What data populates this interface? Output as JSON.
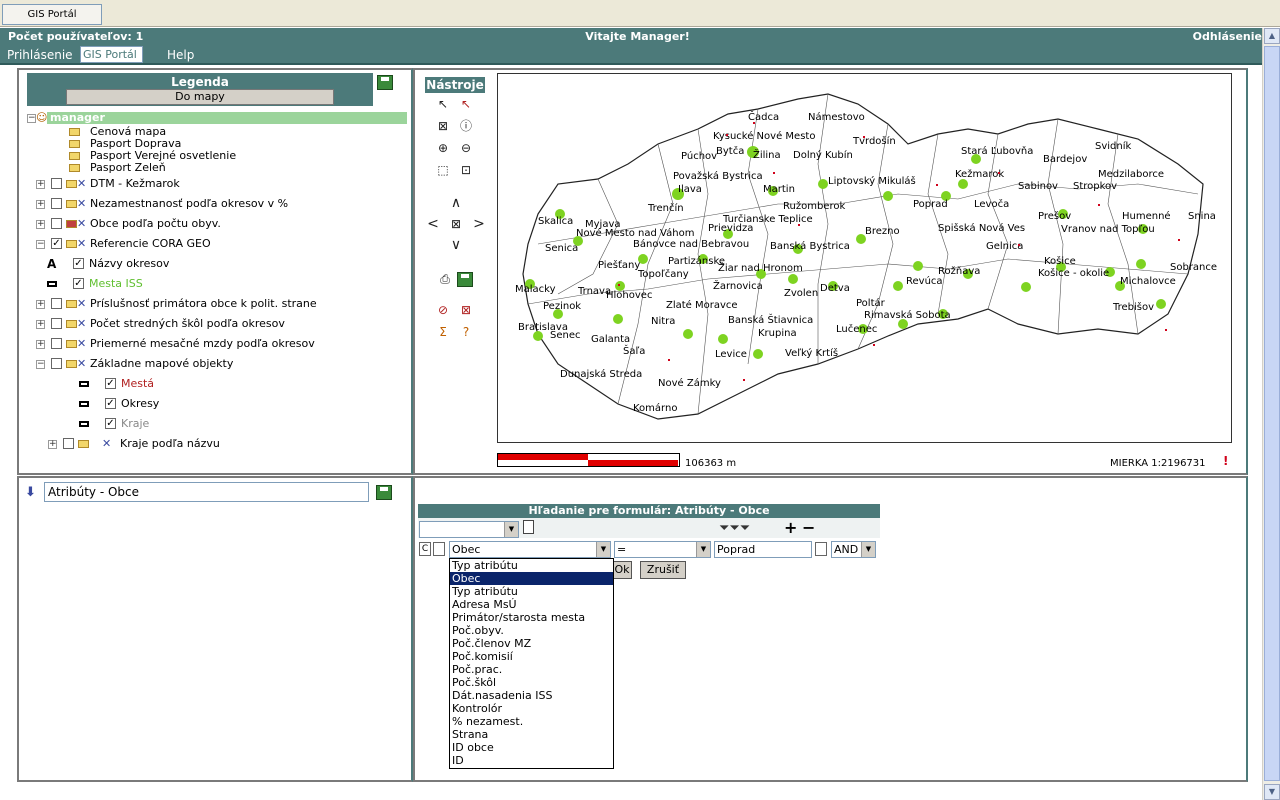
{
  "taskbar": {
    "button_label": "GIS Portál"
  },
  "header": {
    "user_count": "Počet používateľov: 1",
    "welcome": "Vitajte Manager!",
    "logout": "Odhlásenie"
  },
  "menu": {
    "tabs": [
      {
        "label": "Prihlásenie"
      },
      {
        "label": "GIS Portál"
      },
      {
        "label": "Help"
      }
    ]
  },
  "legend": {
    "title": "Legenda",
    "to_map_button": "Do mapy",
    "user": "manager",
    "items": [
      {
        "label": "Cenová mapa"
      },
      {
        "label": "Pasport Doprava"
      },
      {
        "label": "Pasport Verejné osvetlenie"
      },
      {
        "label": "Pasport Zeleň"
      },
      {
        "label": "DTM - Kežmarok"
      },
      {
        "label": "Nezamestnanosť podľa okresov v %"
      },
      {
        "label": "Obce podľa počtu obyv."
      },
      {
        "label": "Referencie CORA GEO"
      },
      {
        "label": "Názvy okresov"
      },
      {
        "label": "Mesta ISS"
      },
      {
        "label": "Príslušnosť primátora obce k polit. strane"
      },
      {
        "label": "Počet stredných škôl podľa okresov"
      },
      {
        "label": "Priemerné mesačné mzdy podľa okresov"
      },
      {
        "label": "Základne mapové objekty"
      },
      {
        "label": "Mestá"
      },
      {
        "label": "Okresy"
      },
      {
        "label": "Kraje"
      },
      {
        "label": "Kraje podľa názvu"
      }
    ]
  },
  "tools": {
    "title": "Nástroje"
  },
  "map": {
    "scale_distance": "106363 m",
    "scale_ratio": "MIERKA 1:2196731",
    "places": [
      {
        "name": "Čadca"
      },
      {
        "name": "Námestovo"
      },
      {
        "name": "Kysucké Nové Mesto"
      },
      {
        "name": "Tvrdošín"
      },
      {
        "name": "Bytča"
      },
      {
        "name": "Púchov"
      },
      {
        "name": "Žilina"
      },
      {
        "name": "Dolný Kubín"
      },
      {
        "name": "Stará Ľubovňa"
      },
      {
        "name": "Svidník"
      },
      {
        "name": "Bardejov"
      },
      {
        "name": "Kežmarok"
      },
      {
        "name": "Medzilaborce"
      },
      {
        "name": "Považská Bystrica"
      },
      {
        "name": "Liptovský Mikuláš"
      },
      {
        "name": "Sabinov"
      },
      {
        "name": "Stropkov"
      },
      {
        "name": "Ilava"
      },
      {
        "name": "Martin"
      },
      {
        "name": "Ružomberok"
      },
      {
        "name": "Poprad"
      },
      {
        "name": "Levoča"
      },
      {
        "name": "Trenčín"
      },
      {
        "name": "Prešov"
      },
      {
        "name": "Humenné"
      },
      {
        "name": "Snina"
      },
      {
        "name": "Skalica"
      },
      {
        "name": "Turčianske Teplice"
      },
      {
        "name": "Vranov nad Topľou"
      },
      {
        "name": "Myjava"
      },
      {
        "name": "Prievidza"
      },
      {
        "name": "Spišská Nová Ves"
      },
      {
        "name": "Nové Mesto nad Váhom"
      },
      {
        "name": "Brezno"
      },
      {
        "name": "Bánovce nad Bebravou"
      },
      {
        "name": "Banská Bystrica"
      },
      {
        "name": "Senica"
      },
      {
        "name": "Gelnica"
      },
      {
        "name": "Partizánske"
      },
      {
        "name": "Piešťany"
      },
      {
        "name": "Žiar nad Hronom"
      },
      {
        "name": "Rožňava"
      },
      {
        "name": "Topoľčany"
      },
      {
        "name": "Košice - okolie"
      },
      {
        "name": "Košice"
      },
      {
        "name": "Sobrance"
      },
      {
        "name": "Revúca"
      },
      {
        "name": "Michalovce"
      },
      {
        "name": "Malacky"
      },
      {
        "name": "Trnava"
      },
      {
        "name": "Žarnovica"
      },
      {
        "name": "Zvolen"
      },
      {
        "name": "Detva"
      },
      {
        "name": "Hlohovec"
      },
      {
        "name": "Zlaté Moravce"
      },
      {
        "name": "Poltár"
      },
      {
        "name": "Pezinok"
      },
      {
        "name": "Trebišov"
      },
      {
        "name": "Rimavská Sobota"
      },
      {
        "name": "Banská Štiavnica"
      },
      {
        "name": "Bratislava"
      },
      {
        "name": "Nitra"
      },
      {
        "name": "Senec"
      },
      {
        "name": "Galanta"
      },
      {
        "name": "Krupina"
      },
      {
        "name": "Lučenec"
      },
      {
        "name": "Šaľa"
      },
      {
        "name": "Levice"
      },
      {
        "name": "Veľký Krtíš"
      },
      {
        "name": "Dunajská Streda"
      },
      {
        "name": "Nové Zámky"
      },
      {
        "name": "Komárno"
      }
    ]
  },
  "attributes": {
    "title": "Atribúty - Obce"
  },
  "search": {
    "title": "Hľadanie pre formulár: Atribúty - Obce",
    "field_selected": "Obec",
    "operator": "=",
    "value": "Poprad",
    "logic": "AND",
    "ok": "Ok",
    "cancel": "Zrušiť",
    "dropdown_options": [
      {
        "label": "Typ atribútu"
      },
      {
        "label": "Obec"
      },
      {
        "label": "Typ atribútu"
      },
      {
        "label": "Adresa MsÚ"
      },
      {
        "label": "Primátor/starosta mesta"
      },
      {
        "label": "Poč.obyv."
      },
      {
        "label": "Poč.členov MZ"
      },
      {
        "label": "Poč.komisií"
      },
      {
        "label": "Poč.prac."
      },
      {
        "label": "Poč.škôl"
      },
      {
        "label": "Dát.nasadenia ISS"
      },
      {
        "label": "Kontrolór"
      },
      {
        "label": "% nezamest."
      },
      {
        "label": "Strana"
      },
      {
        "label": "ID obce"
      },
      {
        "label": "ID"
      }
    ]
  }
}
